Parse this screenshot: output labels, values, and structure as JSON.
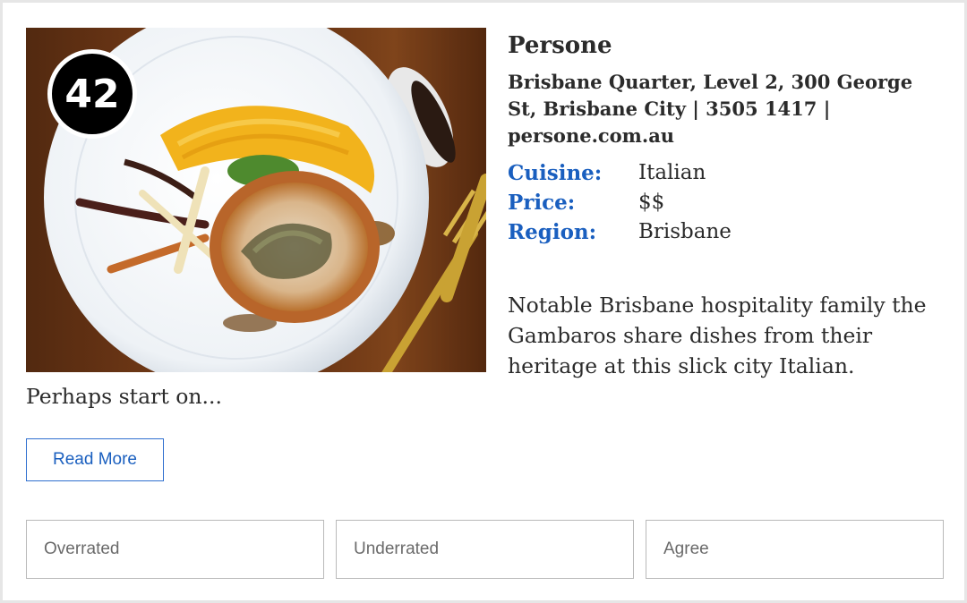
{
  "listing": {
    "rank": "42",
    "name": "Persone",
    "address": "Brisbane Quarter, Level 2, 300 George St, Brisbane City | 3505 1417 | persone.com.au",
    "facts": [
      {
        "label": "Cuisine:",
        "value": "Italian"
      },
      {
        "label": "Price:",
        "value": "$$"
      },
      {
        "label": "Region:",
        "value": "Brisbane"
      }
    ],
    "description": "Notable Brisbane hospitality family the Gambaros share dishes from their heritage at this slick city Italian. Perhaps start on...",
    "read_more_label": "Read More"
  },
  "votes": {
    "overrated": "Overrated",
    "underrated": "Underrated",
    "agree": "Agree"
  },
  "colors": {
    "accent": "#1a5fbf",
    "badge": "#000000",
    "border": "#b9b9b9"
  }
}
